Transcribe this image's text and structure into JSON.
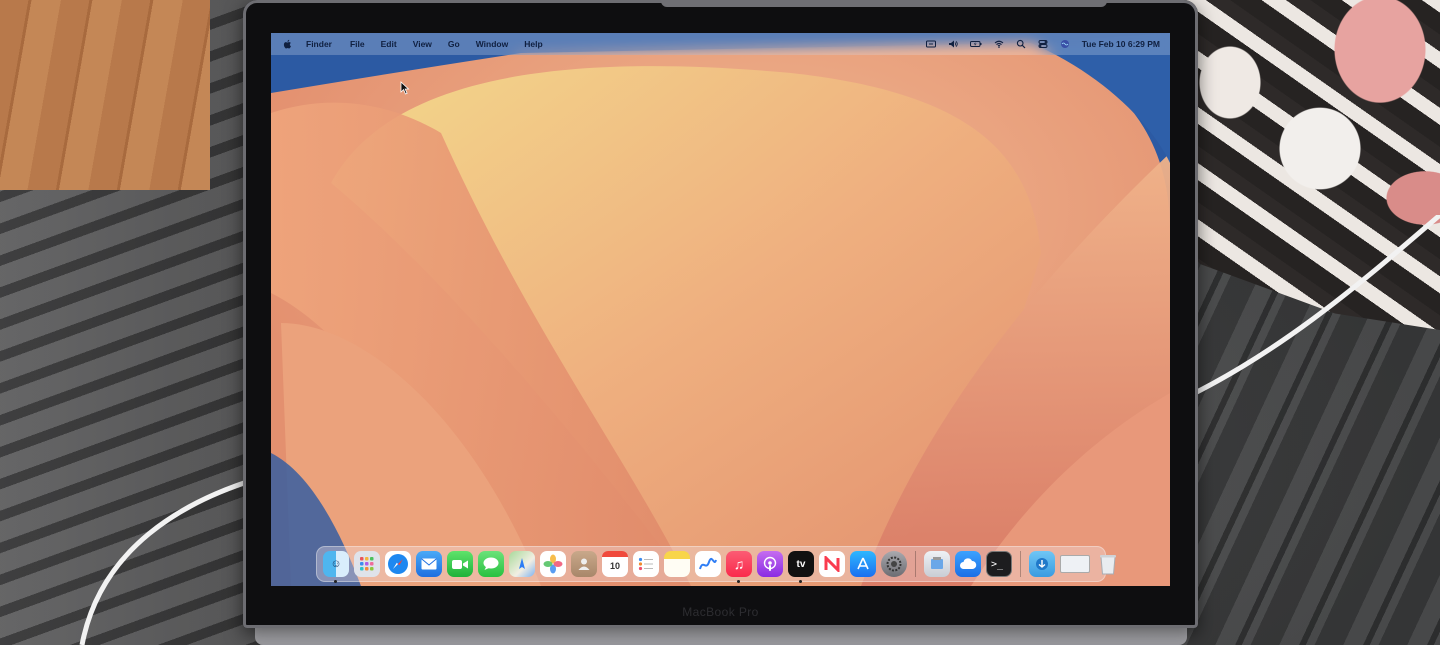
{
  "laptop": {
    "brand_label": "MacBook Pro"
  },
  "menubar": {
    "apple_icon": "apple-logo-icon",
    "app_name": "Finder",
    "menus": [
      "File",
      "Edit",
      "View",
      "Go",
      "Window",
      "Help"
    ],
    "status_icons": [
      "keyboard-icon",
      "volume-icon",
      "battery-charging-icon",
      "wifi-icon",
      "spotlight-search-icon",
      "control-center-icon",
      "siri-icon"
    ],
    "clock": "Tue Feb 10  6:29 PM"
  },
  "dock": {
    "apps": [
      {
        "icon": "finder-icon",
        "running": true
      },
      {
        "icon": "launchpad-icon",
        "running": false
      },
      {
        "icon": "safari-icon",
        "running": false
      },
      {
        "icon": "mail-icon",
        "running": false
      },
      {
        "icon": "facetime-icon",
        "running": false
      },
      {
        "icon": "messages-icon",
        "running": false
      },
      {
        "icon": "maps-icon",
        "running": false
      },
      {
        "icon": "photos-icon",
        "running": false
      },
      {
        "icon": "contacts-icon",
        "running": false
      },
      {
        "icon": "calendar-icon",
        "running": false,
        "label": "10"
      },
      {
        "icon": "reminders-icon",
        "running": false
      },
      {
        "icon": "notes-icon",
        "running": false
      },
      {
        "icon": "freeform-icon",
        "running": false
      },
      {
        "icon": "music-icon",
        "running": true
      },
      {
        "icon": "podcasts-icon",
        "running": false
      },
      {
        "icon": "apple-tv-icon",
        "running": true,
        "label": "tv"
      },
      {
        "icon": "news-icon",
        "running": false
      },
      {
        "icon": "app-store-icon",
        "running": false
      },
      {
        "icon": "system-settings-icon",
        "running": false
      }
    ],
    "utilities": [
      {
        "icon": "preview-icon",
        "running": false
      },
      {
        "icon": "icloud-icon",
        "running": false
      },
      {
        "icon": "terminal-icon",
        "running": false
      }
    ],
    "stacks": [
      {
        "icon": "downloads-folder-icon"
      },
      {
        "icon": "recent-window-icon"
      },
      {
        "icon": "trash-icon"
      }
    ]
  },
  "colors": {
    "wallpaper_blue": "#2f5fa8",
    "wallpaper_peach": "#eea47c",
    "wallpaper_yellow": "#f1d887",
    "bezel": "#0e0e10"
  }
}
